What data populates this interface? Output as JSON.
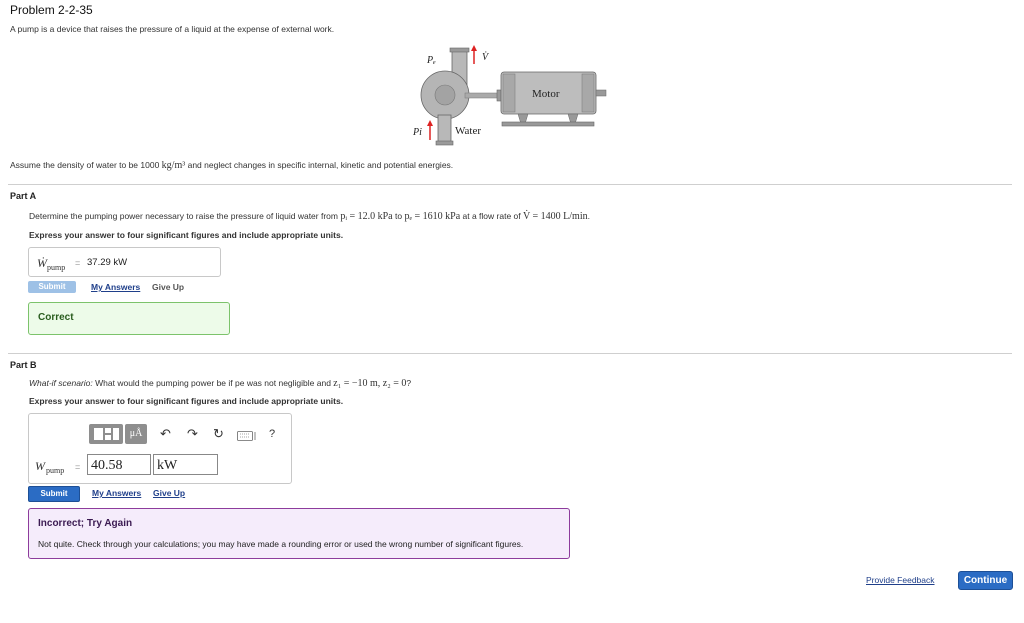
{
  "problem": {
    "title": "Problem 2-2-35",
    "intro": "A pump is a device that raises the pressure of a liquid at the expense of external work.",
    "figure": {
      "label_pe": "Pₑ",
      "label_vdot": "V̇",
      "label_motor": "Motor",
      "label_pi": "Pi",
      "label_water": "Water"
    },
    "assume_pre": "Assume the density of water to be 1000 ",
    "assume_unit": "kg/m³",
    "assume_post": " and neglect changes in specific internal, kinetic and potential energies."
  },
  "part_a": {
    "label": "Part A",
    "q_pre": "Determine the pumping power necessary to raise the pressure of liquid water from ",
    "q_p1": "pᵢ = 12.0 kPa",
    "q_to": " to ",
    "q_p2": "pₑ = 1610 kPa",
    "q_flow": " at a flow rate of ",
    "q_v": "V̇ = 1400 L/min",
    "q_end": ".",
    "instruction": "Express your answer to four significant figures and include appropriate units.",
    "answer_var": "Ẇ",
    "answer_sub": "pump",
    "answer_eq": "=",
    "answer_value": "37.29 kW",
    "submit_label": "Submit",
    "my_answers_label": "My Answers",
    "give_up_label": "Give Up",
    "feedback_title": "Correct"
  },
  "part_b": {
    "label": "Part B",
    "q_italic": "What-if scenario:",
    "q_text": " What would the pumping power be if pe was not negligible and ",
    "q_math": "z₁ = −10 m, z₂ = 0",
    "q_end": "?",
    "instruction": "Express your answer to four significant figures and include appropriate units.",
    "toolbar": {
      "units_label": "μÅ",
      "help_label": "?"
    },
    "answer_var": "W",
    "answer_sub": "pump",
    "answer_eq": "=",
    "value_field": "40.58",
    "unit_field": "kW",
    "submit_label": "Submit",
    "my_answers_label": "My Answers",
    "give_up_label": "Give Up",
    "feedback_title": "Incorrect; Try Again",
    "feedback_body": "Not quite. Check through your calculations; you may have made a rounding error or used the wrong number of significant figures."
  },
  "footer": {
    "feedback_link": "Provide Feedback",
    "continue_label": "Continue"
  },
  "colors": {
    "accent": "#2b6cc4",
    "correct_bg": "#edfbe9",
    "correct_border": "#7cc36b",
    "incorrect_bg": "#f5ecfb",
    "incorrect_border": "#8d3c9c"
  }
}
